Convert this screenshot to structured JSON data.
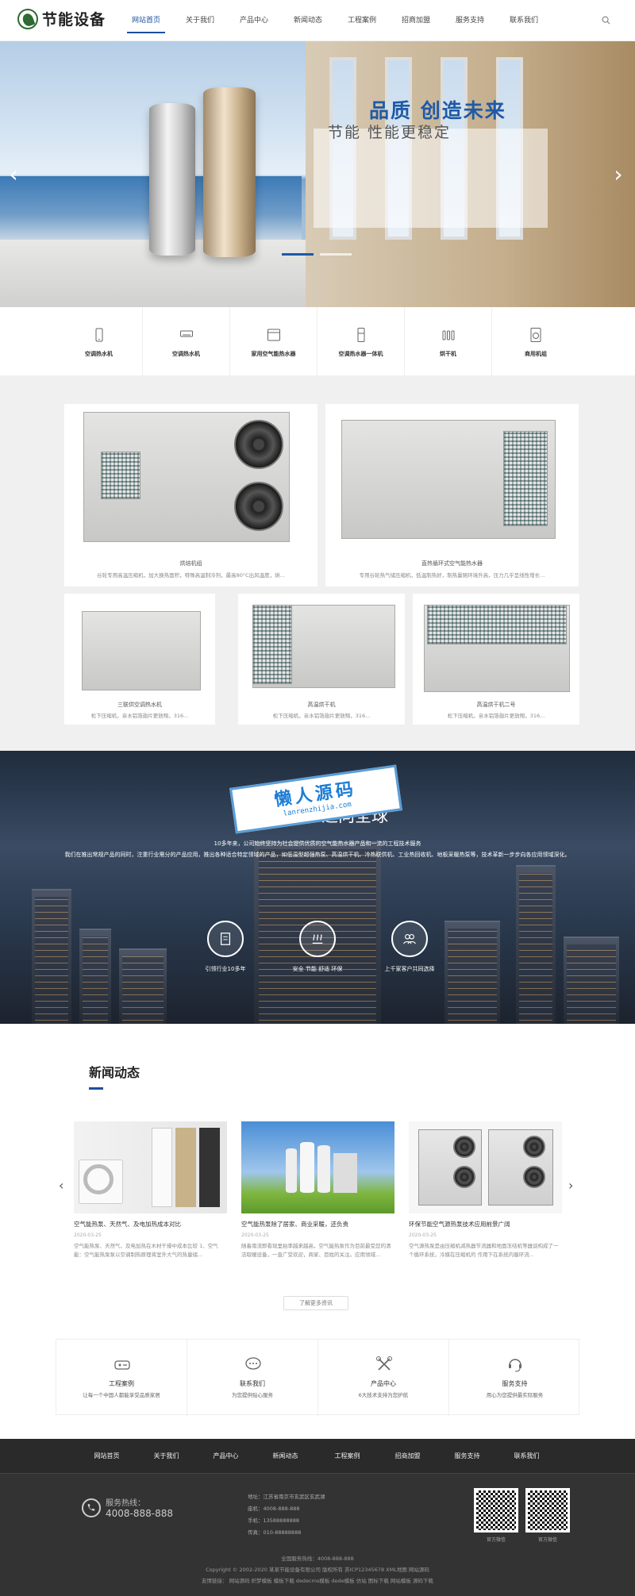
{
  "header": {
    "logo_text": "节能设备",
    "nav": [
      "网站首页",
      "关于我们",
      "产品中心",
      "新闻动态",
      "工程案例",
      "招商加盟",
      "服务支持",
      "联系我们"
    ],
    "active_nav": 0
  },
  "banner": {
    "slogan_main": "品质 创造未来",
    "slogan_sub": "节能 性能更稳定"
  },
  "categories": [
    {
      "label": "空调热水机",
      "icon": "phone-icon"
    },
    {
      "label": "空调热水机",
      "icon": "air-conditioner-icon"
    },
    {
      "label": "家用空气能热水器",
      "icon": "water-heater-icon"
    },
    {
      "label": "空调热水器一体机",
      "icon": "fridge-icon"
    },
    {
      "label": "烘干机",
      "icon": "radiator-icon"
    },
    {
      "label": "商用机组",
      "icon": "washer-icon"
    }
  ],
  "products": [
    {
      "title": "烘焙机组",
      "desc": "谷轮专用高温压缩机，加大换热面积，特殊高温制冷剂，最高80°C出风温度，烘..."
    },
    {
      "title": "直热循环式空气能热水器",
      "desc": "专用谷轮热气储压缩机，低温制热好，制热量随环境升高，压力几乎呈线性增长..."
    },
    {
      "title": "三联供空调热水机",
      "desc": "松下压缩机，亲水铝箔翅片更放翔，316..."
    },
    {
      "title": "高温烘干机",
      "desc": "松下压缩机，亲水铝箔翅片更放翔，316..."
    },
    {
      "title": "高温烘干机二号",
      "desc": "松下压缩机，亲水铝箔翅片更放翔，316..."
    }
  ],
  "about": {
    "watermark_main": "懒人源码",
    "watermark_sub": "lanrenzhijia.com",
    "title": "迈向全球",
    "p1": "10多年来，公司始终坚持为社会提供优质的空气能热水器产品和一流的工程技术服务",
    "p2": "我们在推出常规产品的同时，注重行业需分的产品应用，推出各种适合特定领域的产品，如低温型超强热泵、高温烘干机、冷热联供机、工业热回收机、地板采暖热泵等，技术革新一步步向各应用领域深化。",
    "features": [
      "引领行业10多年",
      "安全 节能 舒适 环保",
      "上千家客户共同选择"
    ]
  },
  "news": {
    "title": "新闻动态",
    "items": [
      {
        "title": "空气能热泵、天然气、及电加热成本对比",
        "date": "2020-03-25",
        "desc": "空气能热泵、天然气、及电加热在木材干燥中成本比较 1、空气能：空气能热泵泵以空调制热原理将室外大气的热量储..."
      },
      {
        "title": "空气能热泵除了居家、商业采暖，还负责",
        "date": "2020-03-25",
        "desc": "随着南流即看现里拍率越来越高，空气能热泵作为目前最受您的清洁取暖设备，一直广受欢迎，商家、百姓的关注。应用领域..."
      },
      {
        "title": "环保节能空气源热泵技术应用前景广阔",
        "date": "2020-03-25",
        "desc": "空气源热泵是由压缩机减热器节流器和地面冻结机等器谈构成了一个循环系统，冷媒在压缩机的 作用下在系统内循环流..."
      }
    ],
    "more": "了解更多资讯"
  },
  "quick": [
    {
      "title": "工程案例",
      "sub": "让每一个中国人都能享受品质家居",
      "icon": "case-icon"
    },
    {
      "title": "联系我们",
      "sub": "为您提供贴心服务",
      "icon": "chat-icon"
    },
    {
      "title": "产品中心",
      "sub": "6大技术支持为您护航",
      "icon": "tools-icon"
    },
    {
      "title": "服务支持",
      "sub": "用心为您提供最实际服务",
      "icon": "support-icon"
    }
  ],
  "footer": {
    "nav": [
      "网站首页",
      "关于我们",
      "产品中心",
      "新闻动态",
      "工程案例",
      "招商加盟",
      "服务支持",
      "联系我们"
    ],
    "hotline_label": "服务热线：",
    "hotline": "4008-888-888",
    "address": "地址：江苏省南京市玄武区玄武湖",
    "tel": "座机：4008-888-888",
    "mobile": "手机：13588888888",
    "fax": "传真：010-88888888",
    "qr1": "官方微信",
    "qr2": "官方微信",
    "line1": "全国服务热线：4008-888-888",
    "line2": "Copyright © 2002-2020 某某节能设备有限公司 版权所有 苏ICP12345678 XML地图 网站源码",
    "line3": "友情链接： 网站源码 织梦模板 模板下载 dedecms模板 dede模板 仿站 图标下载 网站模板 源码下载"
  },
  "colors": {
    "accent": "#1c4f9c",
    "footer_bg": "#333333",
    "section_bg": "#f0f0f0"
  }
}
